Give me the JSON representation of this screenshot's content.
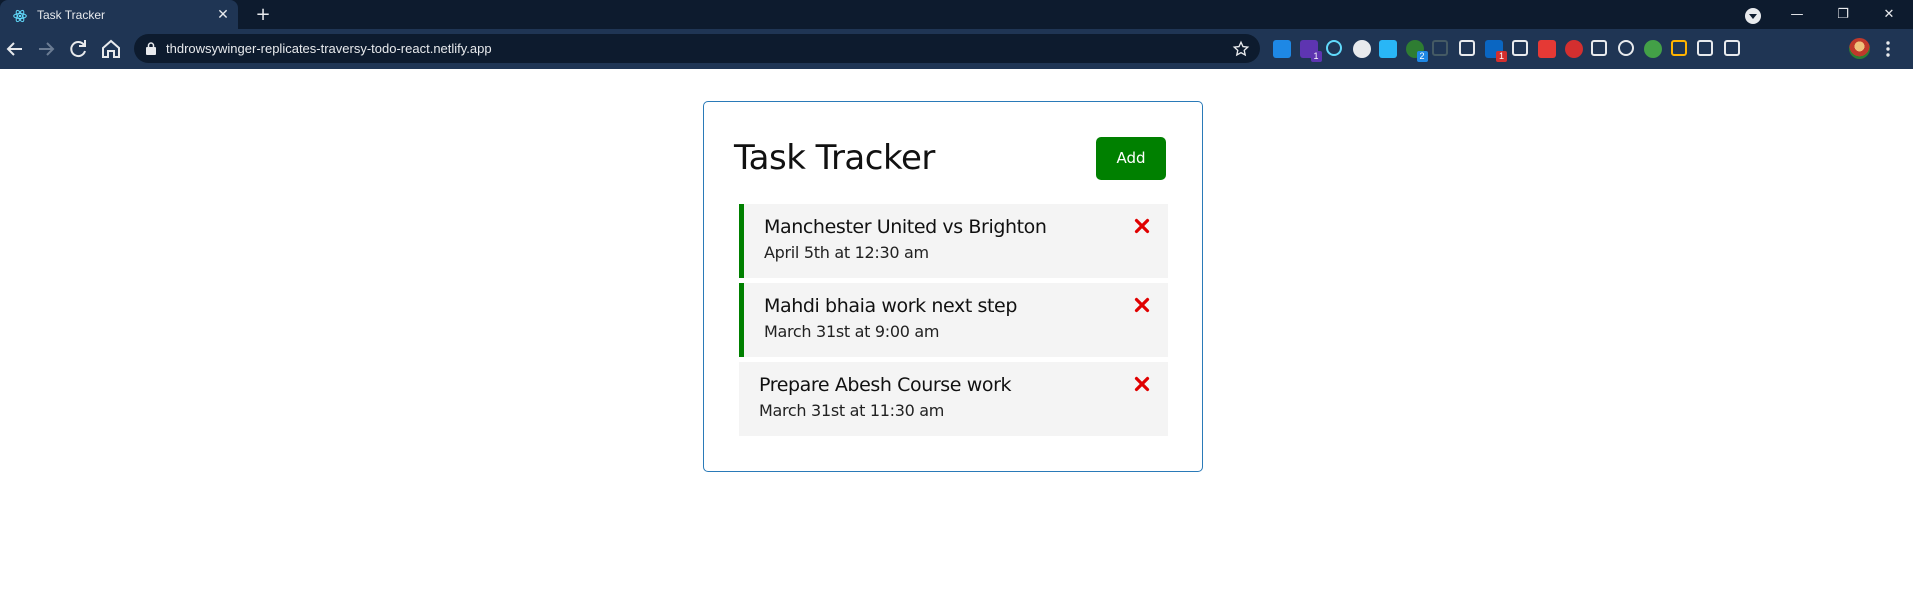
{
  "browser": {
    "tab_title": "Task Tracker",
    "url": "thdrowsywinger-replicates-traversy-todo-react.netlify.app",
    "extensions": [
      {
        "icon": "s-blue-extension-icon",
        "color": "#1e88e5"
      },
      {
        "icon": "cube-extension-icon",
        "color": "#5e35b1",
        "badge": "1"
      },
      {
        "icon": "react-devtools-icon",
        "color": "#61dafb"
      },
      {
        "icon": "circle-extension-icon",
        "color": "#e8eaed"
      },
      {
        "icon": "s-square-extension-icon",
        "color": "#29b6f6"
      },
      {
        "icon": "green-dot-extension-icon",
        "color": "#2e7d32",
        "badge": "2"
      },
      {
        "icon": "recycle-extension-icon",
        "color": "#455a64"
      },
      {
        "icon": "reader-extension-icon",
        "color": "#e8eaed"
      },
      {
        "icon": "linkedin-extension-icon",
        "color": "#0a66c2",
        "badge": "1"
      },
      {
        "icon": "window-extension-icon",
        "color": "#e8eaed"
      },
      {
        "icon": "tp-extension-icon",
        "color": "#e53935"
      },
      {
        "icon": "adblock-plus-icon",
        "color": "#d32f2f"
      },
      {
        "icon": "cursor-extension-icon",
        "color": "#e8eaed"
      },
      {
        "icon": "globe-extension-icon",
        "color": "#e8eaed"
      },
      {
        "icon": "utorrent-extension-icon",
        "color": "#43a047"
      },
      {
        "icon": "eyes-extension-icon",
        "color": "#ffb300"
      },
      {
        "icon": "vue-devtools-icon",
        "color": "#e8eaed"
      },
      {
        "icon": "puzzle-extensions-icon",
        "color": "#e8eaed"
      }
    ],
    "extension_badges": [
      "1",
      "2",
      "1"
    ],
    "colors": {
      "tabbar": "#0d1b2e",
      "toolbar": "#1f3554"
    }
  },
  "app": {
    "title": "Task Tracker",
    "add_label": "Add",
    "colors": {
      "accent": "#008000",
      "border": "#2a7ab8",
      "delete": "#e00000",
      "task_bg": "#f4f4f4"
    },
    "tasks": [
      {
        "text": "Manchester United vs Brighton",
        "day": "April 5th at 12:30 am",
        "reminder": true
      },
      {
        "text": "Mahdi bhaia work next step",
        "day": "March 31st at 9:00 am",
        "reminder": true
      },
      {
        "text": "Prepare Abesh Course work",
        "day": "March 31st at 11:30 am",
        "reminder": false
      }
    ]
  }
}
